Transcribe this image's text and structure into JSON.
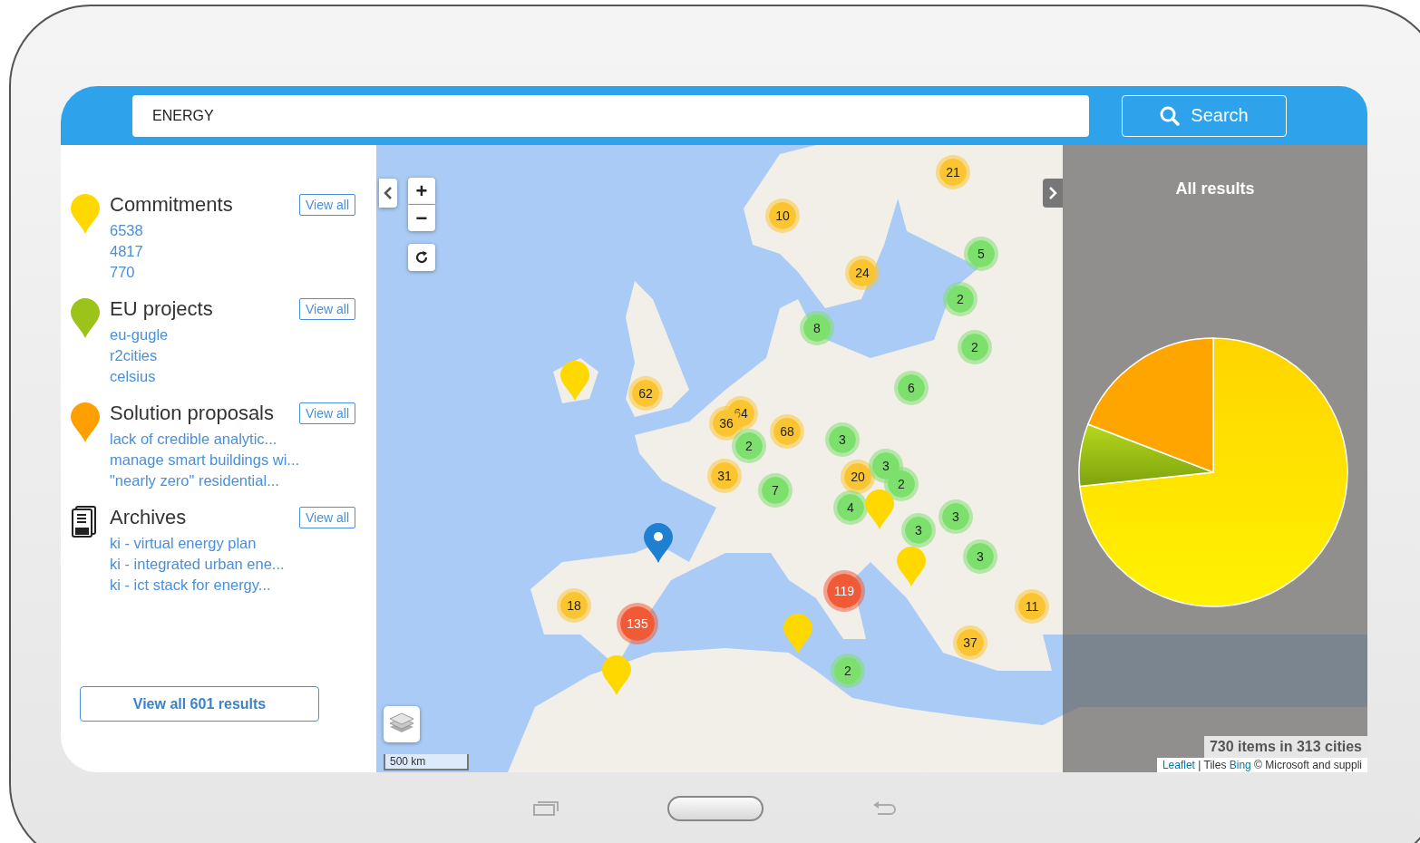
{
  "search": {
    "value": "ENERGY",
    "button": "Search"
  },
  "categories": [
    {
      "kind": "pin",
      "color": "#ffd800",
      "title": "Commitments",
      "view_all": "View all",
      "items": [
        "6538",
        "4817",
        "770"
      ]
    },
    {
      "kind": "pin",
      "color": "#9bc31a",
      "title": "EU projects",
      "view_all": "View all",
      "items": [
        "eu-gugle",
        "r2cities",
        "celsius"
      ]
    },
    {
      "kind": "pin",
      "color": "#ffa000",
      "title": "Solution proposals",
      "view_all": "View all",
      "items": [
        "lack of credible analytic...",
        "manage smart buildings wi...",
        "\"nearly zero\" residential..."
      ]
    },
    {
      "kind": "document",
      "title": "Archives",
      "view_all": "View all",
      "items": [
        "ki - virtual energy plan",
        "ki - integrated urban ene...",
        "ki - ict stack for energy..."
      ]
    }
  ],
  "view_all_results": "View all 601 results",
  "map": {
    "zoom_in": "+",
    "zoom_out": "−",
    "scale": "500 km",
    "clusters": [
      {
        "label": "21",
        "color": "#fbc531"
      },
      {
        "label": "10",
        "color": "#fbc531"
      },
      {
        "label": "5",
        "color": "#7ee06c"
      },
      {
        "label": "24",
        "color": "#fbc531"
      },
      {
        "label": "2",
        "color": "#7ee06c"
      },
      {
        "label": "8",
        "color": "#7ee06c"
      },
      {
        "label": "2",
        "color": "#7ee06c"
      },
      {
        "label": "62",
        "color": "#fbc531"
      },
      {
        "label": "6",
        "color": "#7ee06c"
      },
      {
        "label": "64",
        "color": "#fbc531"
      },
      {
        "label": "36",
        "color": "#fbc531"
      },
      {
        "label": "68",
        "color": "#fbc531"
      },
      {
        "label": "2",
        "color": "#7ee06c"
      },
      {
        "label": "3",
        "color": "#7ee06c"
      },
      {
        "label": "31",
        "color": "#fbc531"
      },
      {
        "label": "7",
        "color": "#7ee06c"
      },
      {
        "label": "20",
        "color": "#fbc531"
      },
      {
        "label": "3",
        "color": "#7ee06c"
      },
      {
        "label": "2",
        "color": "#7ee06c"
      },
      {
        "label": "4",
        "color": "#7ee06c"
      },
      {
        "label": "3",
        "color": "#7ee06c"
      },
      {
        "label": "3",
        "color": "#7ee06c"
      },
      {
        "label": "3",
        "color": "#7ee06c"
      },
      {
        "label": "119",
        "color": "#f15a36"
      },
      {
        "label": "18",
        "color": "#fbc531"
      },
      {
        "label": "11",
        "color": "#fbc531"
      },
      {
        "label": "135",
        "color": "#f15a36"
      },
      {
        "label": "37",
        "color": "#fbc531"
      },
      {
        "label": "2",
        "color": "#7ee06c"
      }
    ],
    "pins": [
      {
        "color": "#ffd800"
      },
      {
        "color": "#ffd800"
      },
      {
        "color": "#ffd800"
      },
      {
        "color": "#ffd800"
      },
      {
        "color": "#ffd800"
      },
      {
        "color": "#1f7fd0"
      }
    ]
  },
  "results_panel": {
    "title": "All results",
    "summary": "730 items in 313 cities"
  },
  "attribution": [
    {
      "kind": "link",
      "text": "Leaflet"
    },
    {
      "kind": "text",
      "text": " | Tiles "
    },
    {
      "kind": "link",
      "text": "Bing"
    },
    {
      "kind": "text",
      "text": " © Microsoft and suppli"
    }
  ]
}
